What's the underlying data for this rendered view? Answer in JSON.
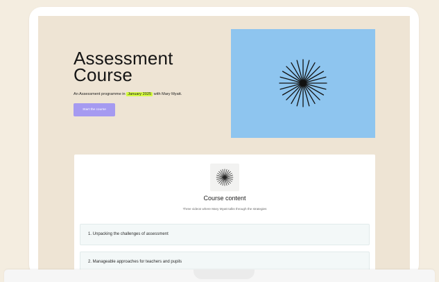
{
  "hero": {
    "title_line1": "Assessment",
    "title_line2": "Course",
    "subtitle_before": "An Assessment programme in",
    "subtitle_highlight": "January 2025",
    "subtitle_after": "with Mary Myatt.",
    "button_label": "Start the course",
    "image_icon": "starburst-icon",
    "image_bg_color": "#8ec5ef",
    "highlight_color": "#d4fb3f",
    "button_color": "#a59af1"
  },
  "course_content": {
    "icon": "starburst-icon",
    "title": "Course content",
    "subtitle": "Three videos where Mary Myatt talks through the strategies",
    "modules": [
      {
        "label": "1. Unpacking the challenges of assessment"
      },
      {
        "label": "2. Manageable approaches for teachers and pupils"
      }
    ]
  },
  "colors": {
    "page_background": "#f4ede0",
    "screen_background": "#eee4d4"
  }
}
